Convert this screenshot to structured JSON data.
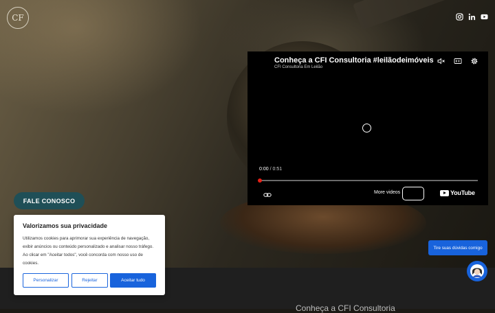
{
  "brand": {
    "logo_text": "CF"
  },
  "social": {
    "icons": [
      "instagram-icon",
      "linkedin-icon",
      "youtube-icon"
    ]
  },
  "video": {
    "title": "Conheça a CFI Consultoria #leilãodeimóveis",
    "channel": "CFI Consultoria Em Leilão",
    "time_current": "0:00",
    "time_separator": "/",
    "time_total": "0:51",
    "more_videos_label": "More videos",
    "youtube_label": "YouTube",
    "progress_fraction": 0.0
  },
  "cta": {
    "label": "FALE CONOSCO"
  },
  "cookie": {
    "title": "Valorizamos sua privacidade",
    "text": "Utilizamos cookies para aprimorar sua experiência de navegação, exibir anúncios ou conteúdo personalizado e analisar nosso tráfego. Ao clicar em \"Aceitar todos\", você concorda com nosso uso de cookies.",
    "customize_label": "Personalizar",
    "reject_label": "Rejeitar",
    "accept_label": "Aceitar tudo"
  },
  "chat": {
    "bubble_text": "Tire suas dúvidas comigo"
  },
  "band": {
    "partial_text": "Conheça a CFI Consultoria"
  },
  "colors": {
    "accent": "#1863dc",
    "cta_bg": "#1f4f57",
    "progress": "#e62117"
  }
}
